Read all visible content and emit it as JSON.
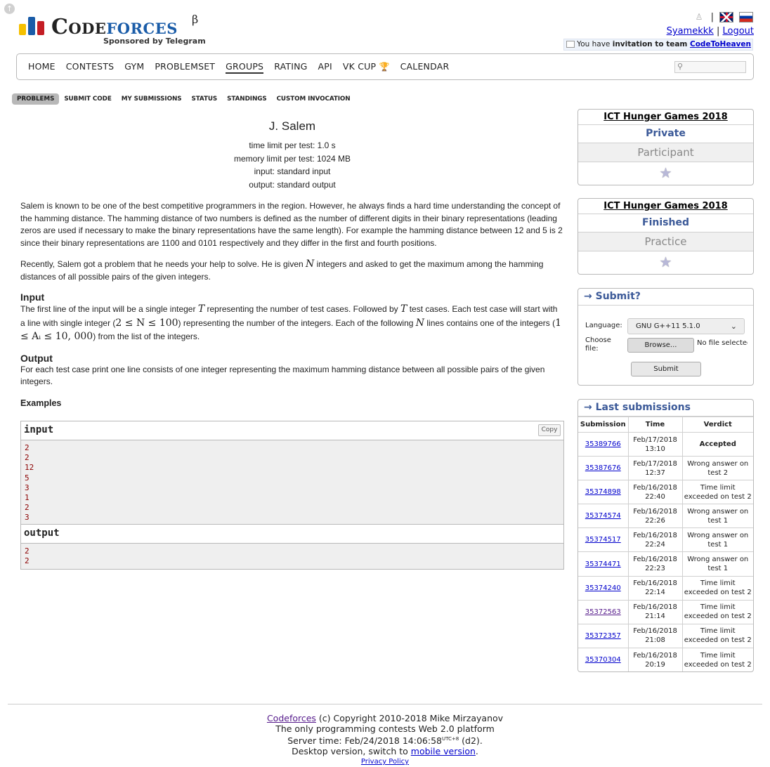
{
  "header": {
    "logo_brand_1": "Code",
    "logo_brand_2": "forces",
    "logo_beta": "β",
    "logo_sponsor": "Sponsored by Telegram",
    "separator": "|",
    "username": "Syamekkk",
    "logout": "Logout",
    "invite_prefix": "You have",
    "invite_bold": "invitation to team",
    "invite_team": "CodeToHeaven"
  },
  "nav": {
    "items": [
      "Home",
      "Contests",
      "Gym",
      "Problemset",
      "Groups",
      "Rating",
      "API",
      "VK Cup",
      "Calendar"
    ],
    "active": "Groups"
  },
  "subnav": {
    "items": [
      "Problems",
      "Submit Code",
      "My Submissions",
      "Status",
      "Standings",
      "Custom Invocation"
    ],
    "active": "Problems"
  },
  "problem": {
    "title": "J. Salem",
    "time_limit": "time limit per test: 1.0 s",
    "memory_limit": "memory limit per test: 1024 MB",
    "input": "input: standard input",
    "output": "output: standard output",
    "legend": "Salem is known to be one of the best competitive programmers in the region. However, he always finds a hard time understanding the concept of the hamming distance. The hamming distance of two numbers is defined as the number of different digits in their binary representations (leading zeros are used if necessary to make the binary representations have the same length). For example the hamming distance between 12 and 5 is 2 since their binary representations are 1100 and 0101 respectively and they differ in the first and fourth positions.",
    "legend2_a": "Recently, Salem got a problem that he needs your help to solve. He is given",
    "legend2_n": "N",
    "legend2_b": "integers and asked to get the maximum among the hamming distances of all possible pairs of the given integers.",
    "input_title": "Input",
    "input_a": "The first line of the input will be a single integer",
    "input_t1": "T",
    "input_b": "representing the number of test cases. Followed by",
    "input_t2": "T",
    "input_c": "test cases. Each test case will start with a line with single integer (",
    "input_m1": "2 ≤ N ≤ 100",
    "input_d": ") representing the number of the integers. Each of the following",
    "input_n": "N",
    "input_e": "lines contains one of the integers (",
    "input_m2": "1 ≤ Aᵢ ≤ 10, 000",
    "input_f": ") from the list of the integers.",
    "output_title": "Output",
    "output_text": "For each test case print one line consists of one integer representing the maximum hamming distance between all possible pairs of the given integers.",
    "examples_title": "Examples",
    "sample_input_label": "input",
    "sample_output_label": "output",
    "copy_label": "Copy",
    "sample_input": [
      "2",
      "2",
      "12",
      "5",
      "3",
      "1",
      "2",
      "3"
    ],
    "sample_output": [
      "2",
      "2"
    ]
  },
  "sidebar": {
    "contest1": {
      "name": "ICT Hunger Games 2018",
      "status": "Private",
      "role": "Participant"
    },
    "contest2": {
      "name": "ICT Hunger Games 2018",
      "status": "Finished",
      "role": "Practice"
    },
    "submit": {
      "caption": "→ Submit?",
      "language_label": "Language:",
      "language_value": "GNU G++11 5.1.0",
      "file_label": "Choose file:",
      "browse": "Browse...",
      "no_file": "No file selected.",
      "submit": "Submit"
    },
    "last": {
      "caption": "→ Last submissions",
      "headers": [
        "Submission",
        "Time",
        "Verdict"
      ],
      "rows": [
        {
          "id": "35389766",
          "time": "Feb/17/2018 13:10",
          "verdict": "Accepted",
          "kind": "ok"
        },
        {
          "id": "35387676",
          "time": "Feb/17/2018 12:37",
          "verdict": "Wrong answer on test 2",
          "kind": "wa"
        },
        {
          "id": "35374898",
          "time": "Feb/16/2018 22:40",
          "verdict": "Time limit exceeded on test 2",
          "kind": "tl"
        },
        {
          "id": "35374574",
          "time": "Feb/16/2018 22:26",
          "verdict": "Wrong answer on test 1",
          "kind": "wa"
        },
        {
          "id": "35374517",
          "time": "Feb/16/2018 22:24",
          "verdict": "Wrong answer on test 1",
          "kind": "wa"
        },
        {
          "id": "35374471",
          "time": "Feb/16/2018 22:23",
          "verdict": "Wrong answer on test 1",
          "kind": "wa"
        },
        {
          "id": "35374240",
          "time": "Feb/16/2018 22:14",
          "verdict": "Time limit exceeded on test 2",
          "kind": "tl"
        },
        {
          "id": "35372563",
          "time": "Feb/16/2018 21:14",
          "verdict": "Time limit exceeded on test 2",
          "kind": "tl"
        },
        {
          "id": "35372357",
          "time": "Feb/16/2018 21:08",
          "verdict": "Time limit exceeded on test 2",
          "kind": "tl"
        },
        {
          "id": "35370304",
          "time": "Feb/16/2018 20:19",
          "verdict": "Time limit exceeded on test 2",
          "kind": "tl"
        }
      ]
    }
  },
  "footer": {
    "link": "Codeforces",
    "copyright": "(c) Copyright 2010-2018 Mike Mirzayanov",
    "tagline": "The only programming contests Web 2.0 platform",
    "server_time_prefix": "Server time: Feb/24/2018 14:06:58",
    "server_tz": "UTC+8",
    "server_suffix": "(d2).",
    "desktop_prefix": "Desktop version, switch to",
    "mobile": "mobile version",
    "period": ".",
    "privacy": "Privacy Policy"
  },
  "colors": {
    "accent": "#3b5998",
    "accepted": "#00a900",
    "link": "#0000cc",
    "sample_text": "#8b0000"
  }
}
